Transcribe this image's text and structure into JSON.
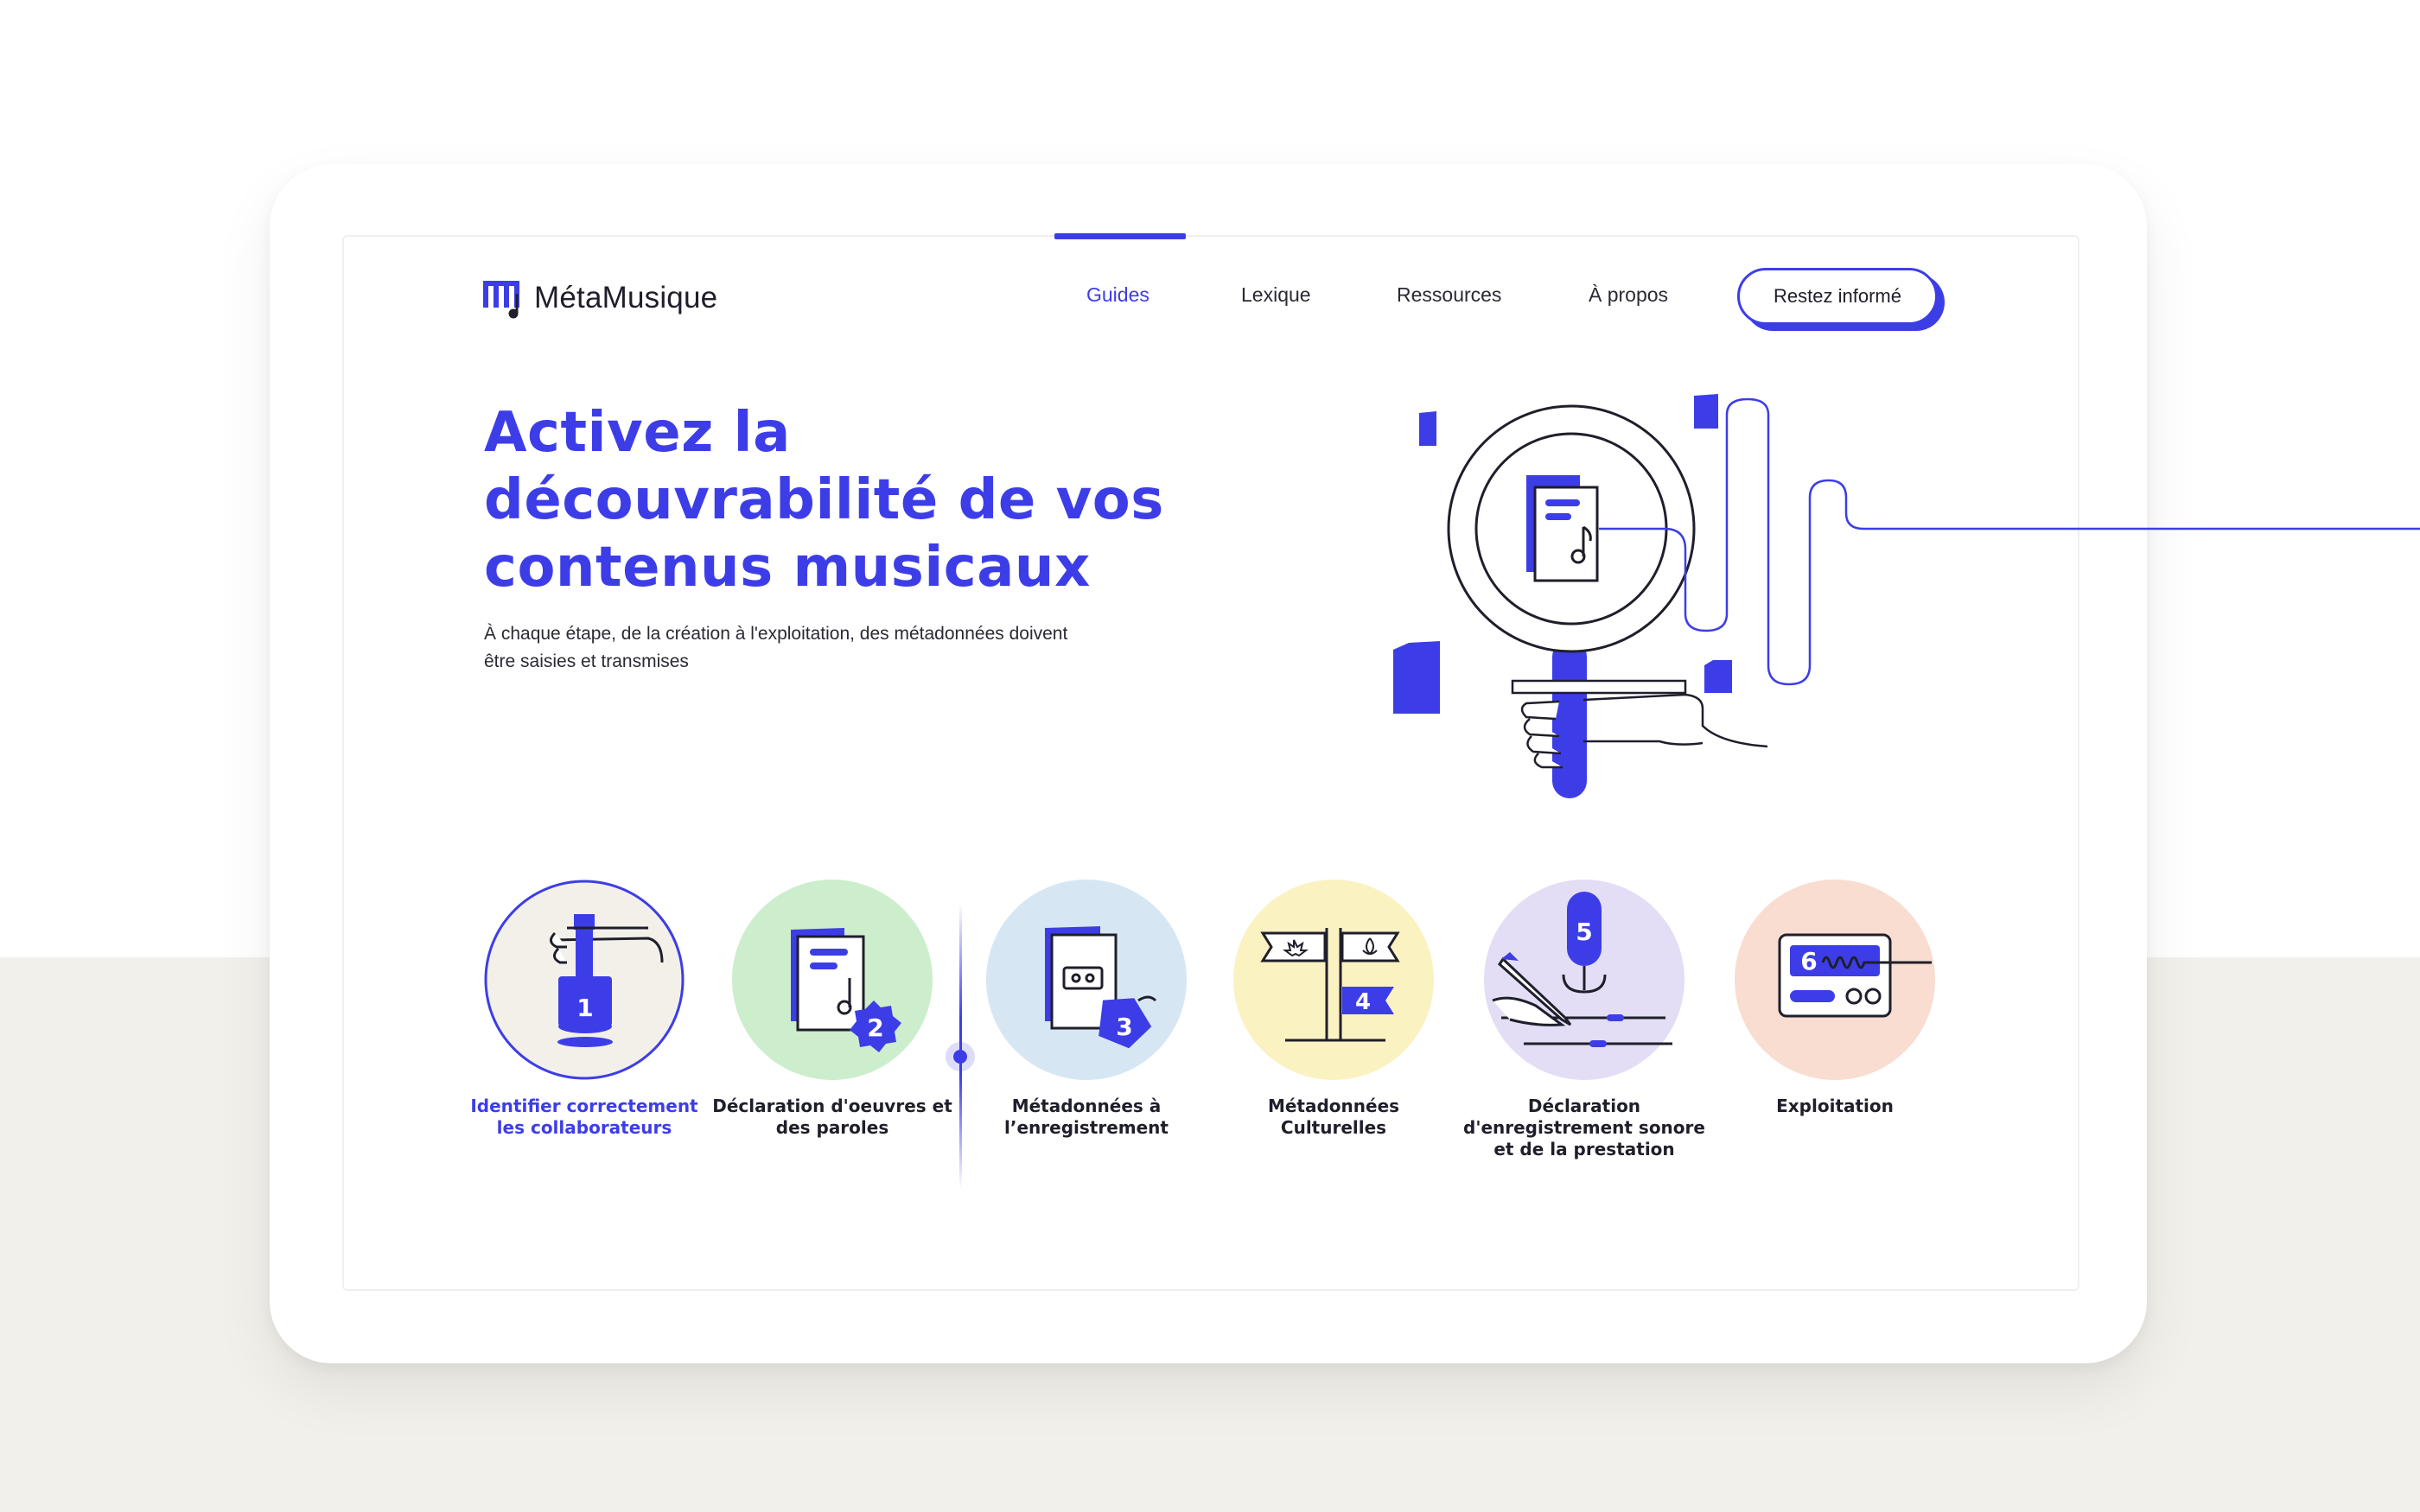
{
  "brand": {
    "name": "MétaMusique",
    "accent": "#3d3de8",
    "logo_icon": "metamusique-logo-icon"
  },
  "nav": {
    "items": [
      {
        "label": "Guides",
        "active": true
      },
      {
        "label": "Lexique",
        "active": false
      },
      {
        "label": "Ressources",
        "active": false
      },
      {
        "label": "À propos",
        "active": false
      }
    ],
    "cta_label": "Restez informé"
  },
  "hero": {
    "title": "Activez la découvrabilité de vos contenus musicaux",
    "subtitle": "À chaque  étape, de la création à l'exploitation, des métadonnées doivent être  saisies et transmises",
    "illustration": "magnifying-glass-document-illustration"
  },
  "steps": [
    {
      "number": "1",
      "label": "Identifier correctement les collaborateurs",
      "color": "#f3f0ea",
      "icon": "hand-stamp-icon",
      "active": true
    },
    {
      "number": "2",
      "label": "Déclaration d'oeuvres et des paroles",
      "color": "#cdeecd",
      "icon": "document-music-icon",
      "active": false
    },
    {
      "number": "3",
      "label": "Métadonnées à l’enregistrement",
      "color": "#d6e7f3",
      "icon": "cassette-tag-icon",
      "active": false
    },
    {
      "number": "4",
      "label": "Métadonnées Culturelles",
      "color": "#fbf2c2",
      "icon": "flags-signpost-icon",
      "active": false
    },
    {
      "number": "5",
      "label": "Déclaration d'enregistrement sonore et de la prestation",
      "color": "#e3def5",
      "icon": "microphone-pen-icon",
      "active": false
    },
    {
      "number": "6",
      "label": "Exploitation",
      "color": "#f8ddd0",
      "icon": "radio-waveform-icon",
      "active": false
    }
  ]
}
